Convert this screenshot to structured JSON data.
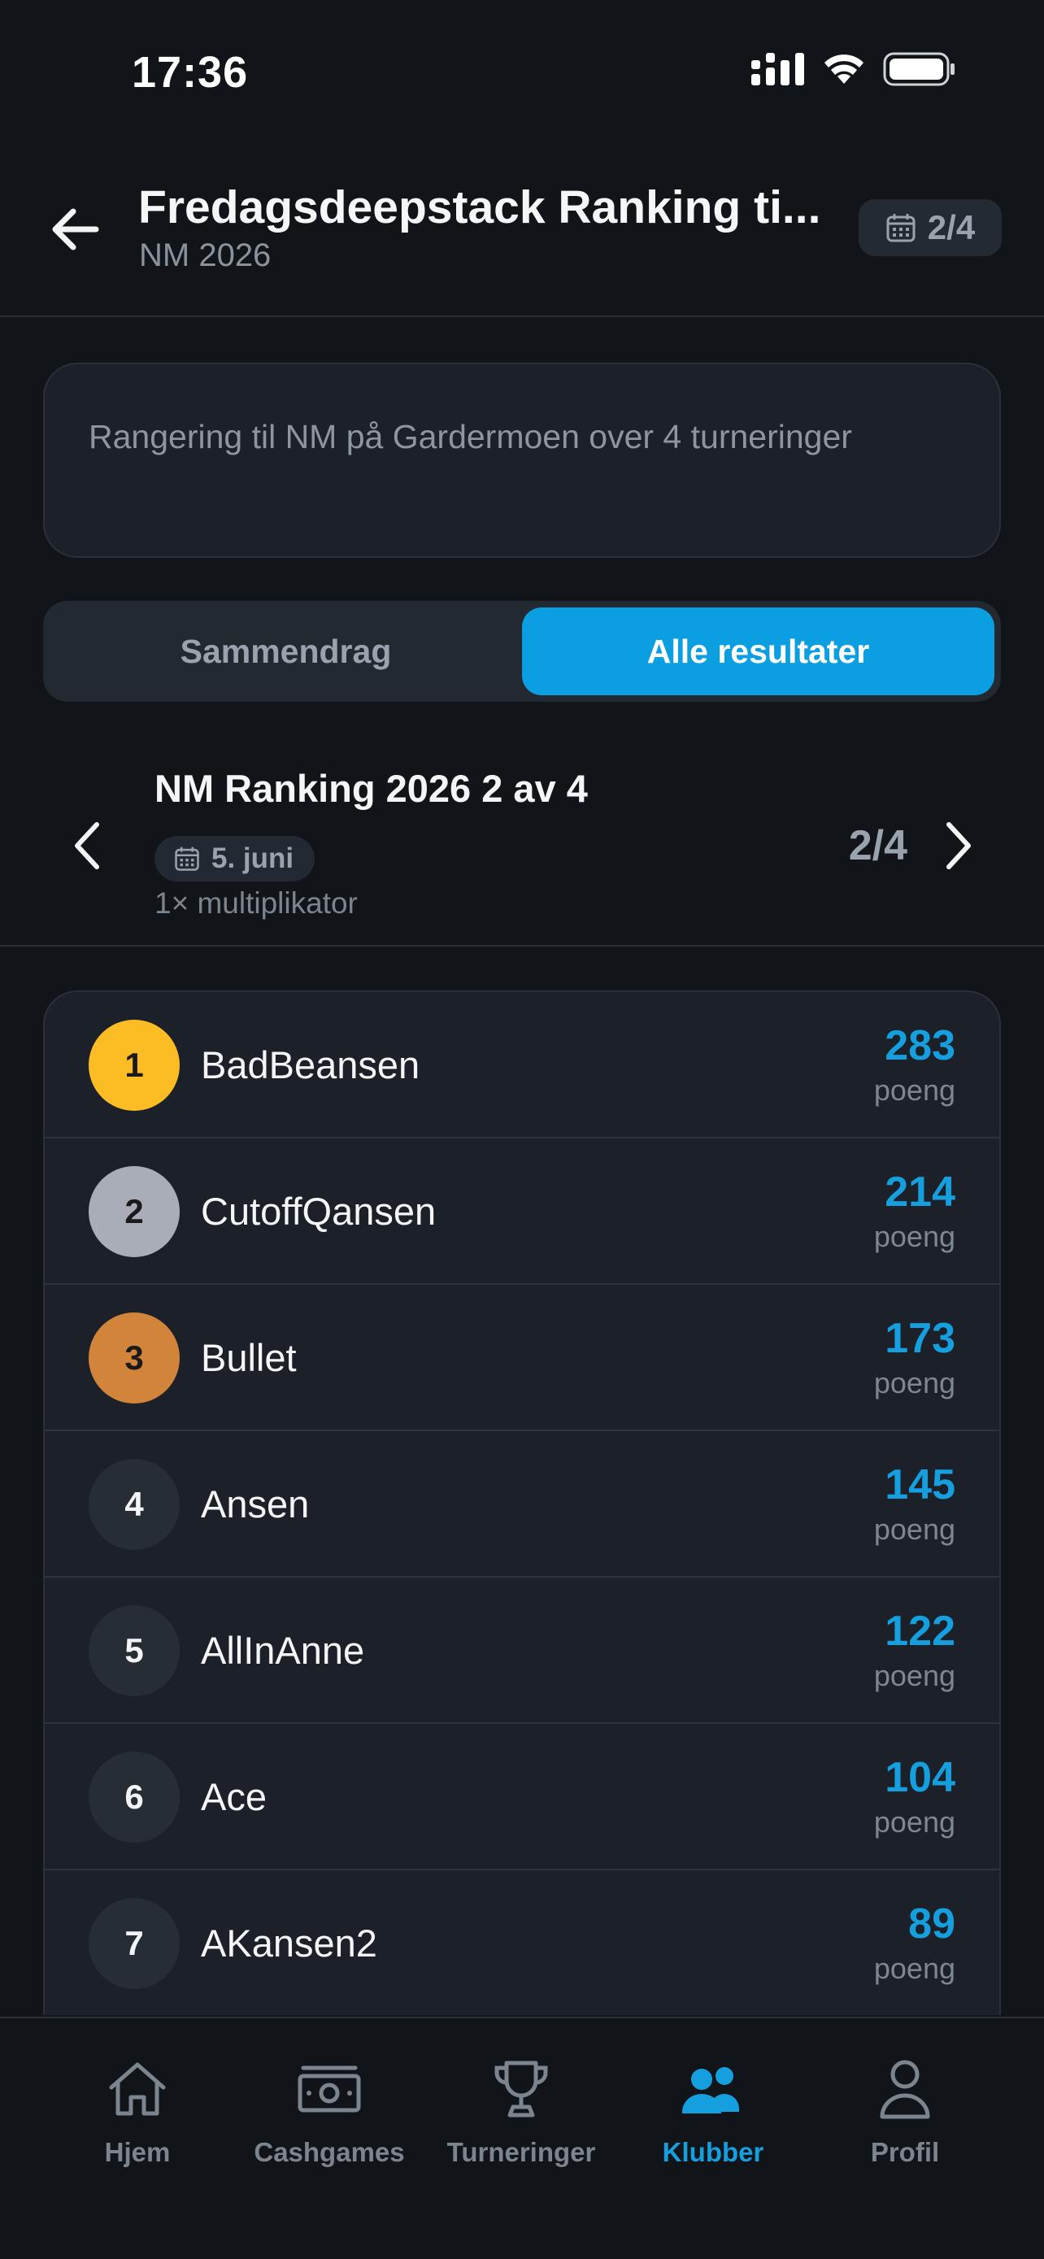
{
  "status_bar": {
    "time": "17:36"
  },
  "header": {
    "title": "Fredagsdeepstack Ranking ti...",
    "subtitle": "NM 2026",
    "round_badge": "2/4"
  },
  "description": "Rangering til NM på Gardermoen over 4 turneringer",
  "segments": [
    {
      "label": "Sammendrag",
      "active": false
    },
    {
      "label": "Alle resultater",
      "active": true
    }
  ],
  "round": {
    "name": "NM Ranking 2026 2 av 4",
    "date": "5. juni",
    "multiplier": "1× multiplikator",
    "counter": "2/4"
  },
  "results": [
    {
      "rank": "1",
      "name": "BadBeansen",
      "points": "283",
      "points_label": "poeng"
    },
    {
      "rank": "2",
      "name": "CutoffQansen",
      "points": "214",
      "points_label": "poeng"
    },
    {
      "rank": "3",
      "name": "Bullet",
      "points": "173",
      "points_label": "poeng"
    },
    {
      "rank": "4",
      "name": "Ansen",
      "points": "145",
      "points_label": "poeng"
    },
    {
      "rank": "5",
      "name": "AllInAnne",
      "points": "122",
      "points_label": "poeng"
    },
    {
      "rank": "6",
      "name": "Ace",
      "points": "104",
      "points_label": "poeng"
    },
    {
      "rank": "7",
      "name": "AKansen2",
      "points": "89",
      "points_label": "poeng"
    }
  ],
  "tabs": [
    {
      "label": "Hjem",
      "icon": "home-icon"
    },
    {
      "label": "Cashgames",
      "icon": "cash-icon"
    },
    {
      "label": "Turneringer",
      "icon": "trophy-icon"
    },
    {
      "label": "Klubber",
      "icon": "people-icon",
      "active": true
    },
    {
      "label": "Profil",
      "icon": "person-icon"
    }
  ],
  "colors": {
    "accent": "#0b9ee0",
    "gold": "#fbbd23",
    "silver": "#a9adb8",
    "bronze": "#d1843a",
    "background": "#111519"
  }
}
